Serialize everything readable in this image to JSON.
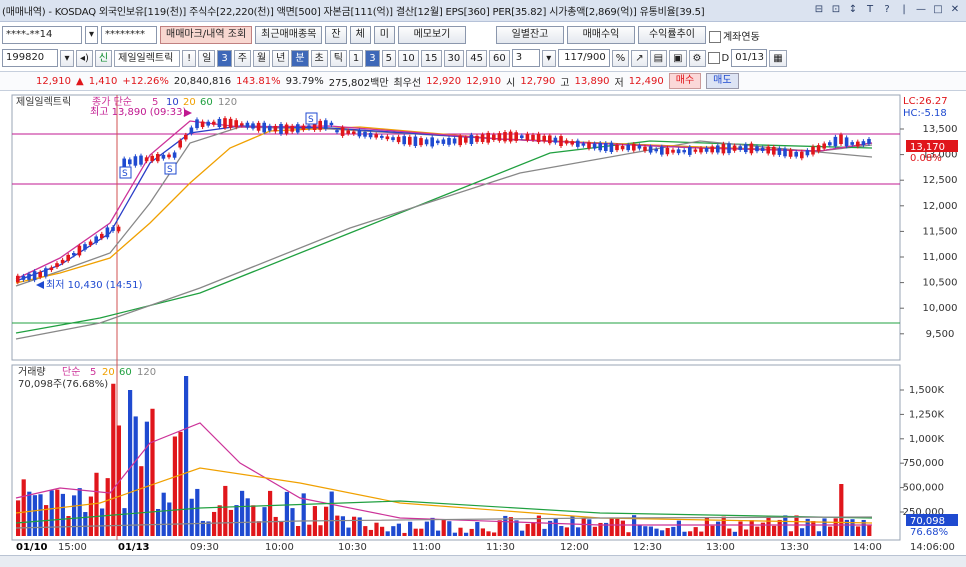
{
  "window": {
    "title": "(매매내역) - KOSDAQ 외국인보유[119(천)] 주식수[22,220(천)] 액면[500] 자본금[111(억)] 결산[12월] EPS[360] PER[35.82] 시가총액[2,869(억)] 유통비율[39.5]",
    "buttons": [
      "⊟",
      "⊡",
      "↕",
      "T",
      "?",
      "|",
      "—",
      "□",
      "✕"
    ]
  },
  "toolbar1": {
    "account": "****-**14",
    "password": "********",
    "trade_query": "매매마크/내역 조회",
    "recent_stocks": "최근매매종목",
    "jan": "잔",
    "che": "체",
    "mi": "미",
    "memo": "메모보기",
    "daily_balance": "일별잔고",
    "trade_profit": "매매수익",
    "profit_trend": "수익률추이",
    "account_link": "계좌연동"
  },
  "toolbar2": {
    "code": "199820",
    "shin": "신",
    "stock_name": "제일일렉트릭",
    "excl": "!",
    "periods": [
      "일",
      "3",
      "주",
      "월",
      "년",
      "분",
      "초",
      "틱",
      "1",
      "3",
      "5",
      "10",
      "15",
      "30",
      "45",
      "60"
    ],
    "selected_periods": [
      "3",
      "분",
      "3"
    ],
    "count_box": "3",
    "range": "117/900",
    "d_label": "D",
    "date": "01/13"
  },
  "quote": {
    "price": "12,910",
    "change": "1,410",
    "change_pct": "+12.26%",
    "volume": "20,840,816",
    "vol_ratio": "143.81%",
    "turnover": "93.79%",
    "trade_value": "275,802백만",
    "best_ask_label": "최우선",
    "best_ask": "12,920",
    "best_bid": "12,910",
    "open_label": "시",
    "open": "12,790",
    "high_label": "고",
    "high": "13,890",
    "low_label": "저",
    "low": "12,490",
    "buy": "매수",
    "sell": "매도"
  },
  "price_panel": {
    "name": "제일일렉트릭",
    "ma_label": "종가 단순",
    "ma_periods": [
      "5",
      "10",
      "20",
      "60",
      "120"
    ],
    "ma_colors": [
      "#cc3399",
      "#2a3ec8",
      "#f0a000",
      "#20a040",
      "#888888"
    ],
    "lc": "LC:26.27",
    "hc": "HC:-5.18",
    "high_note": "최고 13,890 (09:33)",
    "low_note": "최저 10,430 (14:51)",
    "last_price": "13,170",
    "last_pct": "0.08%",
    "s_marks": [
      "S",
      "S",
      "S"
    ],
    "y_labels": [
      "13,500",
      "13,000",
      "12,500",
      "12,000",
      "11,500",
      "11,000",
      "10,500",
      "10,000",
      "9,500"
    ]
  },
  "volume_panel": {
    "name": "거래량",
    "ma_label": "단순",
    "ma_periods": [
      "5",
      "20",
      "60",
      "120"
    ],
    "info": "70,098주(76.68%)",
    "y_labels": [
      "1,500K",
      "1,250K",
      "1,000K",
      "750,000",
      "500,000",
      "250,000"
    ],
    "last_vol": "70,098",
    "last_pct": "76.68%"
  },
  "time_axis": [
    "01/10",
    "15:00",
    "01/13",
    "09:30",
    "10:00",
    "10:30",
    "11:00",
    "11:30",
    "12:00",
    "12:30",
    "13:00",
    "13:30",
    "14:00"
  ],
  "time_now": "14:06:00",
  "colors": {
    "up": "#e0161b",
    "down": "#1f4ad0",
    "magenta_line": "#c01890",
    "green_line": "#20a040"
  }
}
